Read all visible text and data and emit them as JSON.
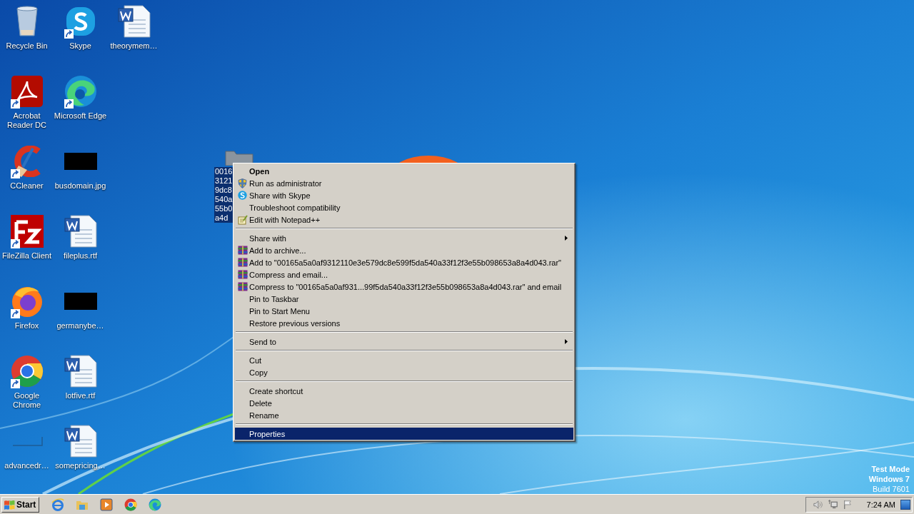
{
  "desktop_icons": [
    {
      "label": "Recycle Bin",
      "kind": "recycle",
      "shortcut": false
    },
    {
      "label": "Acrobat Reader DC",
      "kind": "acrobat",
      "shortcut": true
    },
    {
      "label": "CCleaner",
      "kind": "ccleaner",
      "shortcut": true
    },
    {
      "label": "FileZilla Client",
      "kind": "filezilla",
      "shortcut": true
    },
    {
      "label": "Firefox",
      "kind": "firefox",
      "shortcut": true
    },
    {
      "label": "Google Chrome",
      "kind": "chrome",
      "shortcut": true
    },
    {
      "label": "advancedr…",
      "kind": "blank",
      "shortcut": false
    },
    {
      "label": "Skype",
      "kind": "skype",
      "shortcut": true
    },
    {
      "label": "Microsoft Edge",
      "kind": "edge",
      "shortcut": true
    },
    {
      "label": "busdomain.jpg",
      "shortcut": false
    },
    {
      "label": "fileplus.rtf",
      "kind": "word",
      "shortcut": false
    },
    {
      "label": "germanybe…",
      "shortcut": false
    },
    {
      "label": "lotfive.rtf",
      "kind": "word",
      "shortcut": false
    },
    {
      "label": "somepricing…",
      "kind": "word",
      "shortcut": false
    },
    {
      "label": "theorymem…",
      "kind": "word",
      "shortcut": false
    }
  ],
  "selected_file": {
    "label_lines": [
      "0016",
      "3121",
      "9dc8",
      "540a",
      "55b0",
      "a4d"
    ],
    "selected": true
  },
  "context_menu": [
    {
      "kind": "plain",
      "label": "Open",
      "default": true,
      "submenu": false,
      "selected": false
    },
    {
      "kind": "shield",
      "label": "Run as administrator",
      "default": false,
      "submenu": false,
      "selected": false
    },
    {
      "kind": "skype",
      "label": "Share with Skype",
      "default": false,
      "submenu": false,
      "selected": false
    },
    {
      "kind": "plain",
      "label": "Troubleshoot compatibility",
      "default": false,
      "submenu": false,
      "selected": false
    },
    {
      "kind": "notepad",
      "label": "Edit with Notepad++",
      "default": false,
      "submenu": false,
      "selected": false
    },
    {
      "kind": "separator"
    },
    {
      "kind": "plain",
      "label": "Share with",
      "default": false,
      "submenu": true,
      "selected": false
    },
    {
      "kind": "archive",
      "label": "Add to archive...",
      "default": false,
      "submenu": false,
      "selected": false
    },
    {
      "kind": "archive",
      "label": "Add to \"00165a5a0af9312110e3e579dc8e599f5da540a33f12f3e55b098653a8a4d043.rar\"",
      "default": false,
      "submenu": false,
      "selected": false
    },
    {
      "kind": "archive",
      "label": "Compress and email...",
      "default": false,
      "submenu": false,
      "selected": false
    },
    {
      "kind": "archive",
      "label": "Compress to \"00165a5a0af931...99f5da540a33f12f3e55b098653a8a4d043.rar\" and email",
      "default": false,
      "submenu": false,
      "selected": false
    },
    {
      "kind": "plain",
      "label": "Pin to Taskbar",
      "default": false,
      "submenu": false,
      "selected": false
    },
    {
      "kind": "plain",
      "label": "Pin to Start Menu",
      "default": false,
      "submenu": false,
      "selected": false
    },
    {
      "kind": "plain",
      "label": "Restore previous versions",
      "default": false,
      "submenu": false,
      "selected": false
    },
    {
      "kind": "separator"
    },
    {
      "kind": "plain",
      "label": "Send to",
      "default": false,
      "submenu": true,
      "selected": false
    },
    {
      "kind": "separator"
    },
    {
      "kind": "plain",
      "label": "Cut",
      "default": false,
      "submenu": false,
      "selected": false
    },
    {
      "kind": "plain",
      "label": "Copy",
      "default": false,
      "submenu": false,
      "selected": false
    },
    {
      "kind": "separator"
    },
    {
      "kind": "plain",
      "label": "Create shortcut",
      "default": false,
      "submenu": false,
      "selected": false
    },
    {
      "kind": "plain",
      "label": "Delete",
      "default": false,
      "submenu": false,
      "selected": false
    },
    {
      "kind": "plain",
      "label": "Rename",
      "default": false,
      "submenu": false,
      "selected": false
    },
    {
      "kind": "separator"
    },
    {
      "kind": "plain",
      "label": "Properties",
      "default": false,
      "submenu": false,
      "selected": true
    }
  ],
  "os_watermark": [
    "Test Mode",
    "Windows 7",
    "Build 7601"
  ],
  "taskbar": {
    "start_label": "Start",
    "clock": "7:24 AM"
  }
}
